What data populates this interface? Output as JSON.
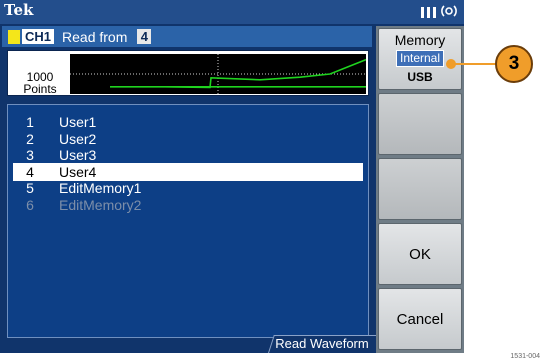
{
  "titlebar": {
    "logo": "Tek",
    "status_icons": [
      "grid-icon",
      "tekvisa-icon"
    ]
  },
  "header": {
    "channel": "CH1",
    "read_from_label": "Read from",
    "read_from_value": "4"
  },
  "preview": {
    "points_value": "1000",
    "points_label": "Points",
    "waveform_color": "#1fd31f",
    "waveform_shape": [
      0.1,
      0.1,
      0.1,
      0.08,
      0.38,
      0.32,
      0.4,
      0.5,
      0.95,
      0.95
    ]
  },
  "list": {
    "items": [
      {
        "index": "1",
        "name": "User1",
        "state": "normal"
      },
      {
        "index": "2",
        "name": "User2",
        "state": "normal"
      },
      {
        "index": "3",
        "name": "User3",
        "state": "normal"
      },
      {
        "index": "4",
        "name": "User4",
        "state": "selected"
      },
      {
        "index": "5",
        "name": "EditMemory1",
        "state": "normal"
      },
      {
        "index": "6",
        "name": "EditMemory2",
        "state": "disabled"
      }
    ],
    "tab_label": "Read Waveform"
  },
  "softkeys": {
    "memory_title": "Memory",
    "memory_internal": "Internal",
    "memory_usb": "USB",
    "ok": "OK",
    "cancel": "Cancel"
  },
  "callout": {
    "number": "3",
    "color": "#f09d2a"
  },
  "figure_code": "1531-004"
}
